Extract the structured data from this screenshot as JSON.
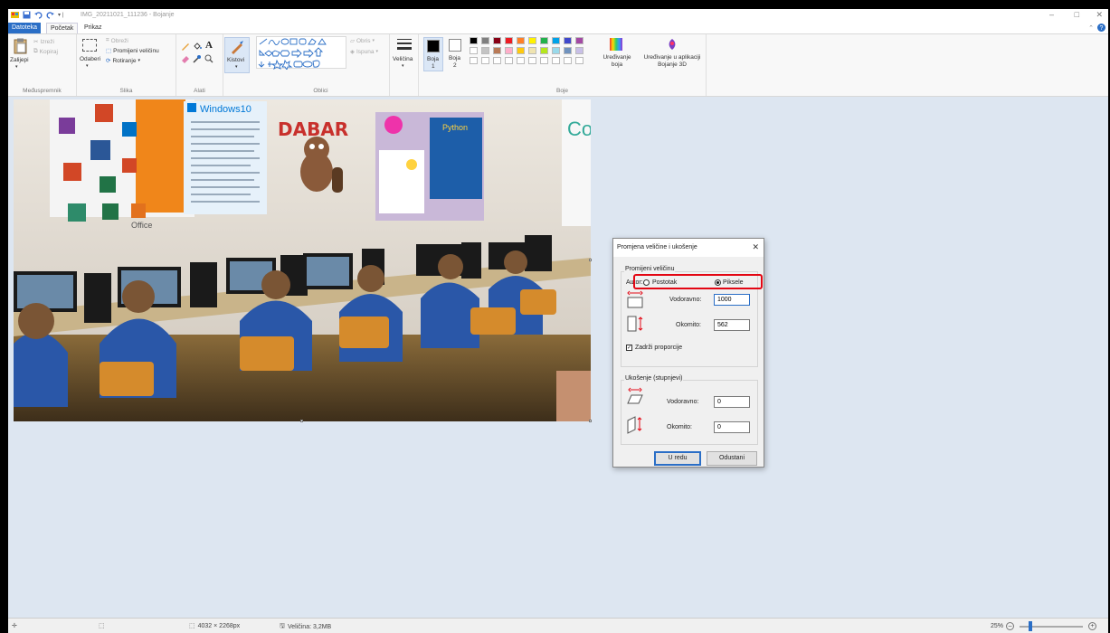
{
  "window": {
    "title": "IMG_20211021_111236 - Bojanje",
    "minimize": "–",
    "maximize": "□",
    "close": "✕"
  },
  "tabs": [
    {
      "label": "Datoteka"
    },
    {
      "label": "Početak"
    },
    {
      "label": "Prikaz"
    }
  ],
  "ribbon": {
    "clipboard": {
      "paste": "Zalijepi",
      "cut": "Izreži",
      "copy": "Kopiraj",
      "label": "Međuspremnik"
    },
    "image": {
      "select": "Odaberi",
      "crop": "Obreži",
      "resize": "Promijeni veličinu",
      "rotate": "Rotiranje",
      "label": "Slika"
    },
    "tools": {
      "label": "Alati"
    },
    "brushes": {
      "label": "Kistovi"
    },
    "shapes": {
      "outline": "Obris",
      "fill": "Ispuna",
      "label": "Oblici"
    },
    "size": {
      "label": "Veličina"
    },
    "color1": {
      "label": "Boja",
      "sub": "1"
    },
    "color2": {
      "label": "Boja",
      "sub": "2"
    },
    "colors": {
      "edit": "Uređivanje boja",
      "paint3d": "Uređivanje u aplikaciji Bojanje 3D",
      "label": "Boje"
    },
    "palette": [
      "#000000",
      "#7f7f7f",
      "#880015",
      "#ed1c24",
      "#ff7f27",
      "#fff200",
      "#22b14c",
      "#00a2e8",
      "#3f48cc",
      "#a349a4",
      "#ffffff",
      "#c3c3c3",
      "#b97a57",
      "#ffaec9",
      "#ffc90e",
      "#efe4b0",
      "#b5e61d",
      "#99d9ea",
      "#7092be",
      "#c8bfe7"
    ]
  },
  "dialog": {
    "title": "Promjena veličine i ukošenje",
    "close": "✕",
    "resize_group": "Promijeni veličinu",
    "by_label": "Autor:",
    "percent": "Postotak",
    "pixels": "Piksele",
    "horizontal_label": "Vodoravno:",
    "horizontal_value": "1000",
    "vertical_label": "Okomito:",
    "vertical_value": "562",
    "keep_ratio": "Zadrži proporcije",
    "skew_group": "Ukošenje (stupnjevi)",
    "skew_h_label": "Vodoravno:",
    "skew_h_value": "0",
    "skew_v_label": "Okomito:",
    "skew_v_value": "0",
    "ok": "U redu",
    "cancel": "Odustani"
  },
  "photo": {
    "wall_sign": "DABAR",
    "windows": "Windows10",
    "python": "Python",
    "office": "Office",
    "corner": "Co"
  },
  "status": {
    "dimensions": "4032 × 2268px",
    "size": "Veličina: 3,2MB",
    "zoom": "25%",
    "zoom_fraction": 0.25
  },
  "colors": {
    "accent": "#2a6ec6",
    "highlight": "#e30613",
    "canvas_bg": "#dde6f1"
  }
}
